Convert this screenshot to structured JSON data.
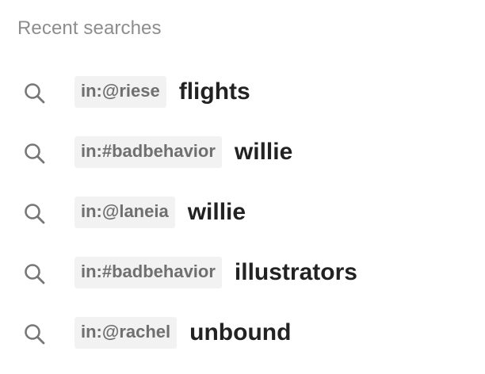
{
  "recent": {
    "heading": "Recent searches",
    "items": [
      {
        "filter": "in:@riese",
        "term": "flights",
        "icon": "search-icon"
      },
      {
        "filter": "in:#badbehavior",
        "term": "willie",
        "icon": "search-icon"
      },
      {
        "filter": "in:@laneia",
        "term": "willie",
        "icon": "search-icon"
      },
      {
        "filter": "in:#badbehavior",
        "term": "illustrators",
        "icon": "search-icon"
      },
      {
        "filter": "in:@rachel",
        "term": "unbound",
        "icon": "search-icon"
      }
    ]
  },
  "colors": {
    "icon": "#777777",
    "chip_bg": "#f2f2f2",
    "chip_text": "#6f6f6f",
    "term_text": "#222222",
    "heading_text": "#8d8d8d"
  }
}
